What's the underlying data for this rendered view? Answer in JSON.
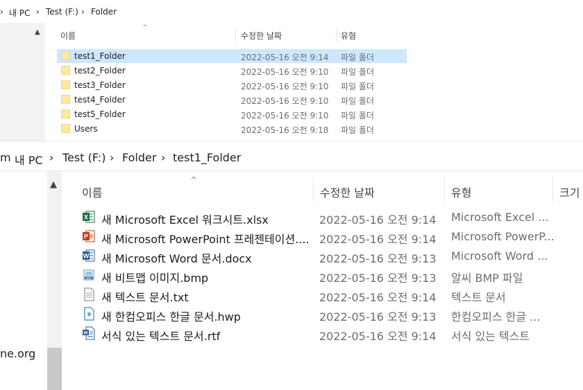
{
  "top": {
    "breadcrumb": [
      "내 PC",
      "Test (F:)",
      "Folder"
    ],
    "columns": {
      "name": "이름",
      "modified": "수정한 날짜",
      "type": "유형"
    },
    "rows": [
      {
        "name": "test1_Folder",
        "modified": "2022-05-16 오전 9:14",
        "type": "파일 폴더",
        "selected": true
      },
      {
        "name": "test2_Folder",
        "modified": "2022-05-16 오전 9:10",
        "type": "파일 폴더"
      },
      {
        "name": "test3_Folder",
        "modified": "2022-05-16 오전 9:10",
        "type": "파일 폴더"
      },
      {
        "name": "test4_Folder",
        "modified": "2022-05-16 오전 9:10",
        "type": "파일 폴더"
      },
      {
        "name": "test5_Folder",
        "modified": "2022-05-16 오전 9:10",
        "type": "파일 폴더"
      },
      {
        "name": "Users",
        "modified": "2022-05-16 오전 9:18",
        "type": "파일 폴더"
      }
    ]
  },
  "bottom": {
    "breadcrumb_lead": "m",
    "breadcrumb": [
      "내 PC",
      "Test (F:)",
      "Folder",
      "test1_Folder"
    ],
    "columns": {
      "name": "이름",
      "modified": "수정한 날짜",
      "type": "유형",
      "size": "크기"
    },
    "nav_partial_item": "ne.org",
    "rows": [
      {
        "icon": "excel-icon",
        "name": "새 Microsoft Excel 워크시트.xlsx",
        "modified": "2022-05-16 오전 9:14",
        "type": "Microsoft Excel ..."
      },
      {
        "icon": "powerpoint-icon",
        "name": "새 Microsoft PowerPoint 프레젠테이션....",
        "modified": "2022-05-16 오전 9:14",
        "type": "Microsoft PowerP..."
      },
      {
        "icon": "word-icon",
        "name": "새 Microsoft Word 문서.docx",
        "modified": "2022-05-16 오전 9:13",
        "type": "Microsoft Word ..."
      },
      {
        "icon": "bitmap-icon",
        "name": "새 비트맵 이미지.bmp",
        "modified": "2022-05-16 오전 9:13",
        "type": "알씨 BMP 파일"
      },
      {
        "icon": "text-file-icon",
        "name": "새 텍스트 문서.txt",
        "modified": "2022-05-16 오전 9:14",
        "type": "텍스트 문서"
      },
      {
        "icon": "hwp-icon",
        "name": "새 한컴오피스 한글 문서.hwp",
        "modified": "2022-05-16 오전 9:13",
        "type": "한컴오피스 한글 ..."
      },
      {
        "icon": "rtf-icon",
        "name": "서식 있는 텍스트 문서.rtf",
        "modified": "2022-05-16 오전 9:14",
        "type": "서식 있는 텍스트"
      }
    ]
  },
  "colors": {
    "selection": "#cce8ff",
    "folder": "#ffe9a0",
    "excel": "#1d6f42",
    "powerpoint": "#c43e1c",
    "word": "#2b579a"
  }
}
